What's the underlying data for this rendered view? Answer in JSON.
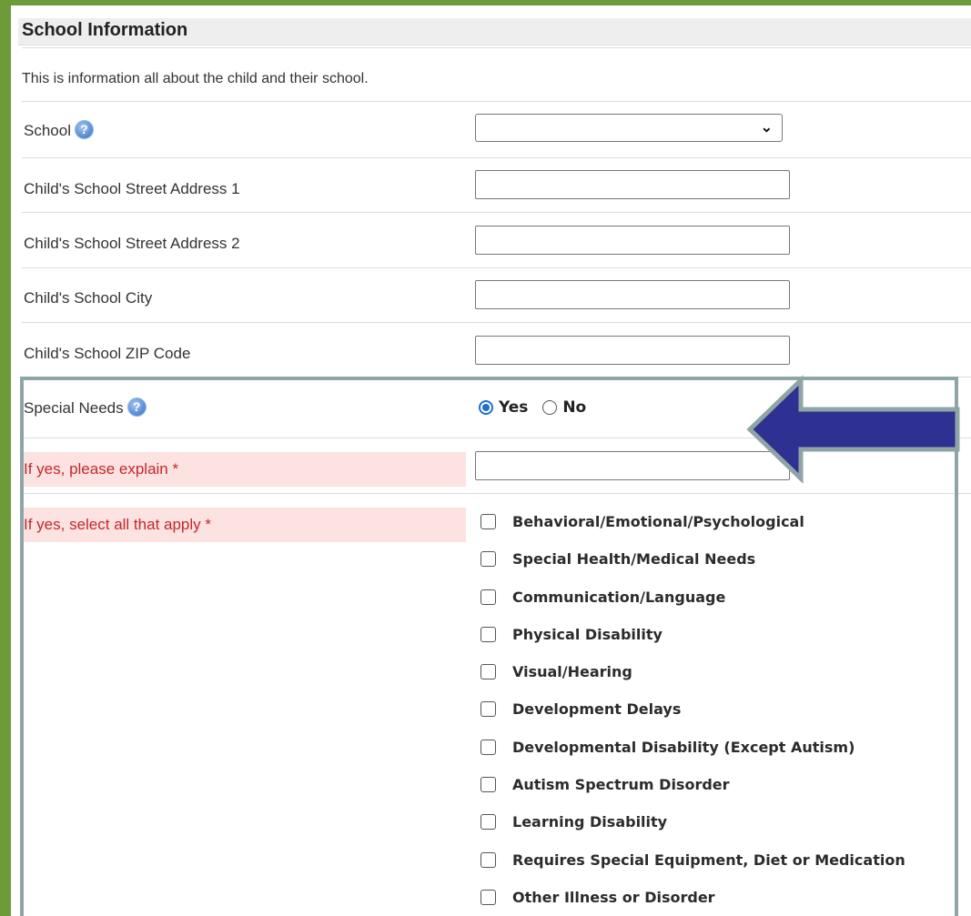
{
  "section": {
    "title": "School Information",
    "intro": "This is information all about the child and their school."
  },
  "fields": {
    "school": {
      "label": "School",
      "value": ""
    },
    "address1": {
      "label": "Child's School Street Address 1",
      "value": ""
    },
    "address2": {
      "label": "Child's School Street Address 2",
      "value": ""
    },
    "city": {
      "label": "Child's School City",
      "value": ""
    },
    "zip": {
      "label": "Child's School ZIP Code",
      "value": ""
    }
  },
  "special_needs": {
    "label": "Special Needs",
    "options": {
      "yes": "Yes",
      "no": "No"
    },
    "selected": "Yes",
    "explain_label": "If yes, please explain *",
    "explain_value": "",
    "select_label": "If yes, select all that apply *",
    "checklist": [
      "Behavioral/Emotional/Psychological",
      "Special Health/Medical Needs",
      "Communication/Language",
      "Physical Disability",
      "Visual/Hearing",
      "Development Delays",
      "Developmental Disability (Except Autism)",
      "Autism Spectrum Disorder",
      "Learning Disability",
      "Requires Special Equipment, Diet or Medication",
      "Other Illness or Disorder"
    ]
  },
  "icons": {
    "help": "help-question-icon",
    "annotation": "left-arrow-annotation"
  },
  "colors": {
    "page_border": "#6e9b3a",
    "required_bg": "#fde2e2",
    "required_text": "#c0292b",
    "arrow_fill": "#2e3192",
    "highlight_border": "#8fa5a5"
  }
}
